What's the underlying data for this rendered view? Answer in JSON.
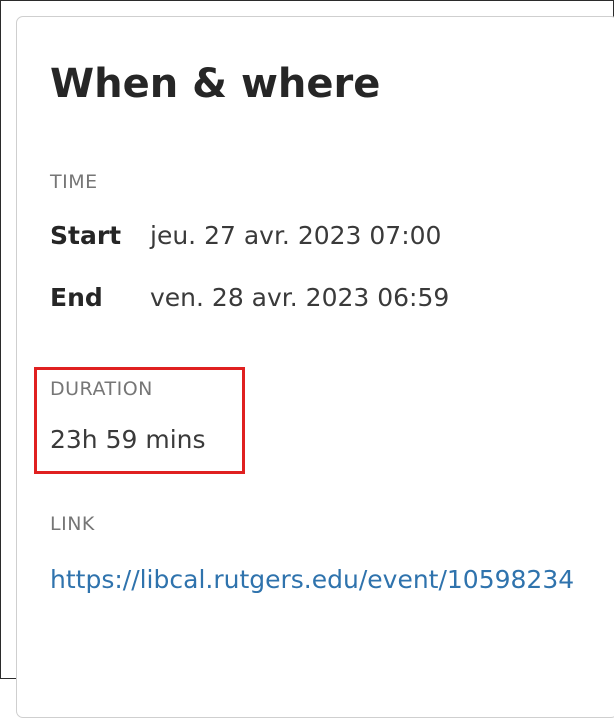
{
  "panel": {
    "title": "When & where"
  },
  "time": {
    "label": "TIME",
    "start_label": "Start",
    "start_value": "jeu. 27 avr. 2023 07:00",
    "end_label": "End",
    "end_value": "ven. 28 avr. 2023 06:59"
  },
  "duration": {
    "label": "DURATION",
    "value": "23h 59 mins"
  },
  "link": {
    "label": "LINK",
    "url": "https://libcal.rutgers.edu/event/10598234"
  },
  "colors": {
    "highlight": "#e02020",
    "link": "#2f73ad"
  }
}
